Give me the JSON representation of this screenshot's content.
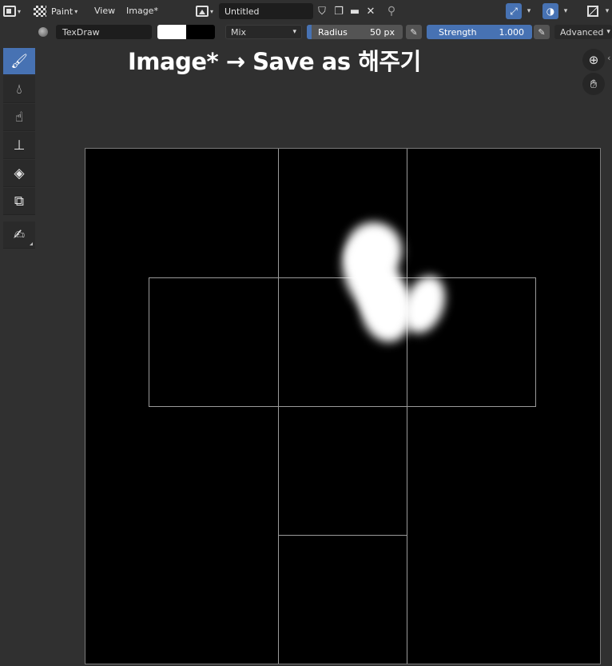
{
  "header": {
    "mode_label": "Paint",
    "menu_view": "View",
    "menu_image": "Image*",
    "image_name": "Untitled"
  },
  "tool_settings": {
    "brush_name": "TexDraw",
    "primary_color": "#ffffff",
    "secondary_color": "#000000",
    "blend_mode": "Mix",
    "radius_label": "Radius",
    "radius_value": "50 px",
    "strength_label": "Strength",
    "strength_value": "1.000",
    "strength_fraction": 1.0,
    "advanced_label": "Advanced"
  },
  "annotation": "Image* → Save as 해주기",
  "tools": [
    {
      "name": "draw",
      "icon": "brush-icon",
      "active": true
    },
    {
      "name": "soften",
      "icon": "droplet-icon",
      "active": false
    },
    {
      "name": "smear",
      "icon": "smear-icon",
      "active": false
    },
    {
      "name": "clone",
      "icon": "stamp-icon",
      "active": false
    },
    {
      "name": "fill",
      "icon": "paint-bucket-icon",
      "active": false
    },
    {
      "name": "mask",
      "icon": "mask-icon",
      "active": false
    },
    {
      "name": "annotate",
      "icon": "annotate-pen-icon",
      "active": false
    }
  ],
  "navigation": [
    {
      "name": "zoom",
      "icon": "zoom-icon"
    },
    {
      "name": "pan",
      "icon": "hand-icon"
    }
  ],
  "colors": {
    "accent": "#4772b3",
    "panel": "#303030",
    "field": "#1d1d1d",
    "canvas": "#000000",
    "uv_lines": "#9a9a9a"
  }
}
